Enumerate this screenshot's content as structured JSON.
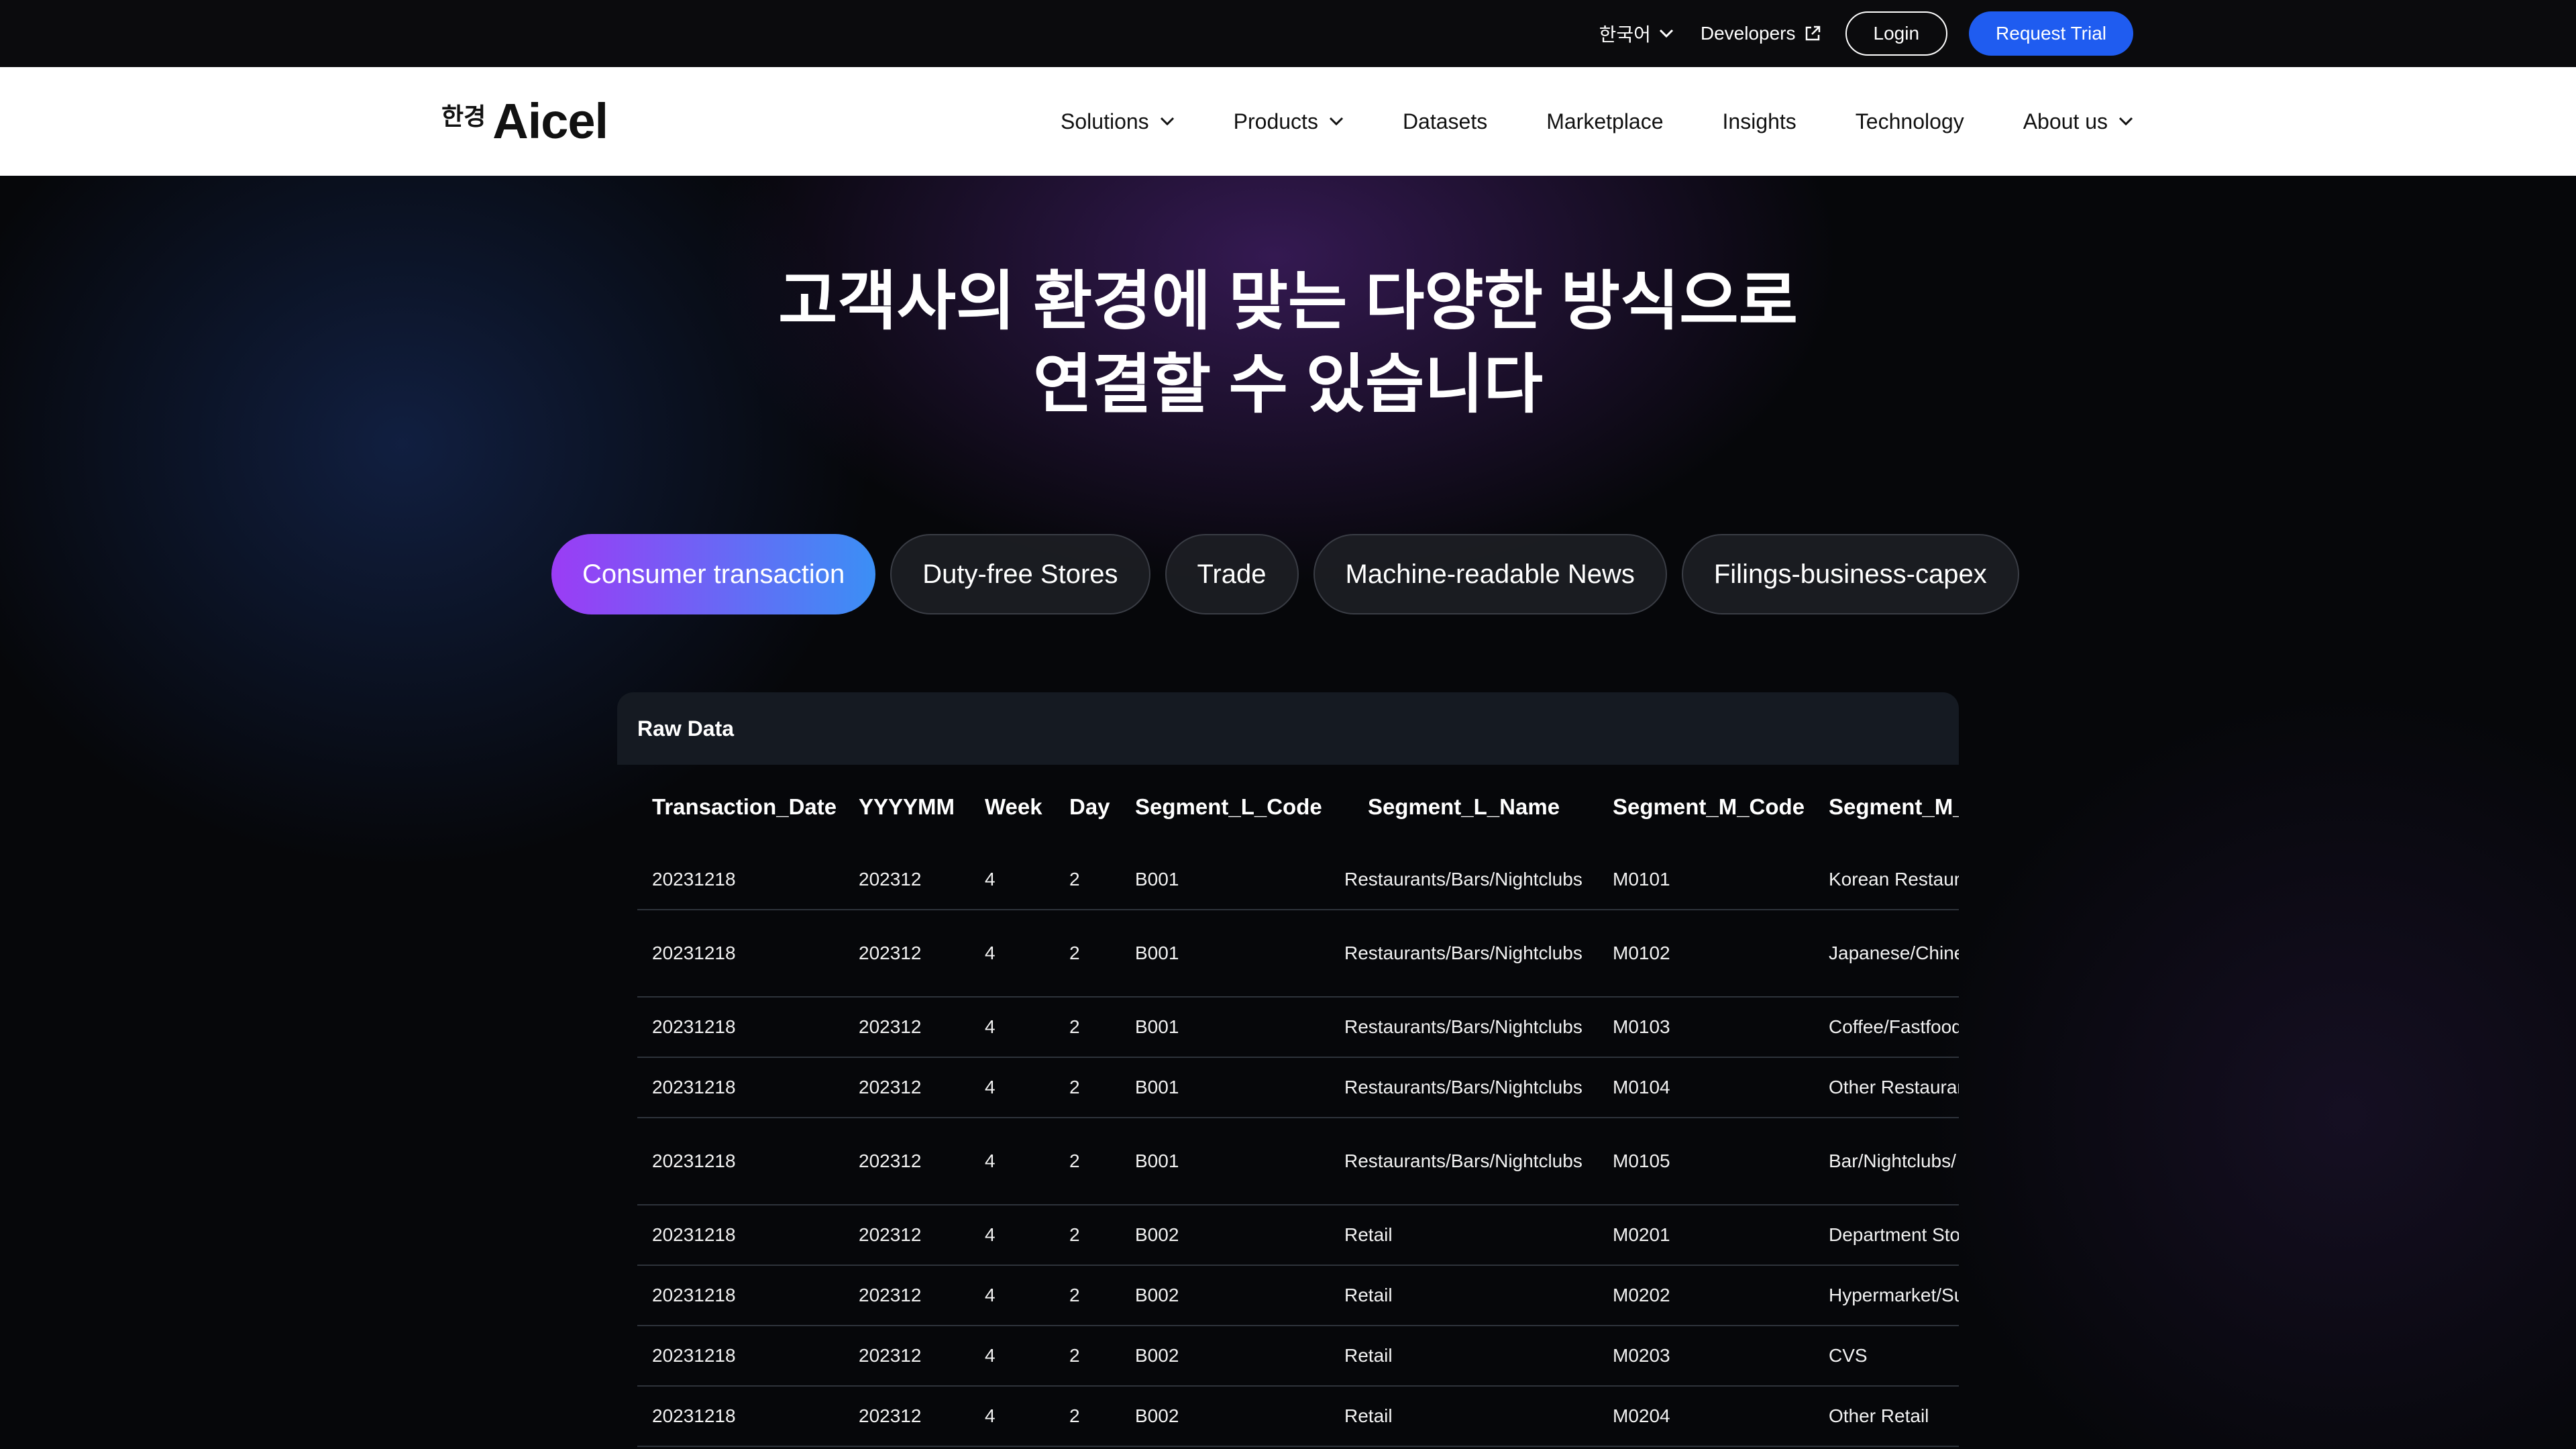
{
  "topbar": {
    "language": "한국어",
    "developers": "Developers",
    "login": "Login",
    "request_trial": "Request Trial"
  },
  "nav": {
    "logo_kr": "한경",
    "logo_en": "Aicel",
    "items": [
      "Solutions",
      "Products",
      "Datasets",
      "Marketplace",
      "Insights",
      "Technology",
      "About us"
    ]
  },
  "hero": {
    "title_line1": "고객사의 환경에 맞는 다양한 방식으로",
    "title_line2": "연결할 수 있습니다"
  },
  "tabs": [
    "Consumer transaction",
    "Duty-free Stores",
    "Trade",
    "Machine-readable News",
    "Filings-business-capex"
  ],
  "raw_data": {
    "title": "Raw Data",
    "columns": [
      "Transaction_Date",
      "YYYYMM",
      "Week",
      "Day",
      "Segment_L_Code",
      "Segment_L_Name",
      "Segment_M_Code",
      "Segment_M_Name"
    ],
    "rows": [
      [
        "20231218",
        "202312",
        "4",
        "2",
        "B001",
        "Restaurants/Bars/Nightclubs",
        "M0101",
        "Korean Restaurants"
      ],
      [
        "20231218",
        "202312",
        "4",
        "2",
        "B001",
        "Restaurants/Bars/Nightclubs",
        "M0102",
        "Japanese/Chinese Dining"
      ],
      [
        "20231218",
        "202312",
        "4",
        "2",
        "B001",
        "Restaurants/Bars/Nightclubs",
        "M0103",
        "Coffee/Fastfood"
      ],
      [
        "20231218",
        "202312",
        "4",
        "2",
        "B001",
        "Restaurants/Bars/Nightclubs",
        "M0104",
        "Other Restaurants"
      ],
      [
        "20231218",
        "202312",
        "4",
        "2",
        "B001",
        "Restaurants/Bars/Nightclubs",
        "M0105",
        "Bar/Nightclubs/ Entertainments"
      ],
      [
        "20231218",
        "202312",
        "4",
        "2",
        "B002",
        "Retail",
        "M0201",
        "Department Stores"
      ],
      [
        "20231218",
        "202312",
        "4",
        "2",
        "B002",
        "Retail",
        "M0202",
        "Hypermarket/Supermarket"
      ],
      [
        "20231218",
        "202312",
        "4",
        "2",
        "B002",
        "Retail",
        "M0203",
        "CVS"
      ],
      [
        "20231218",
        "202312",
        "4",
        "2",
        "B002",
        "Retail",
        "M0204",
        "Other Retail"
      ]
    ]
  }
}
